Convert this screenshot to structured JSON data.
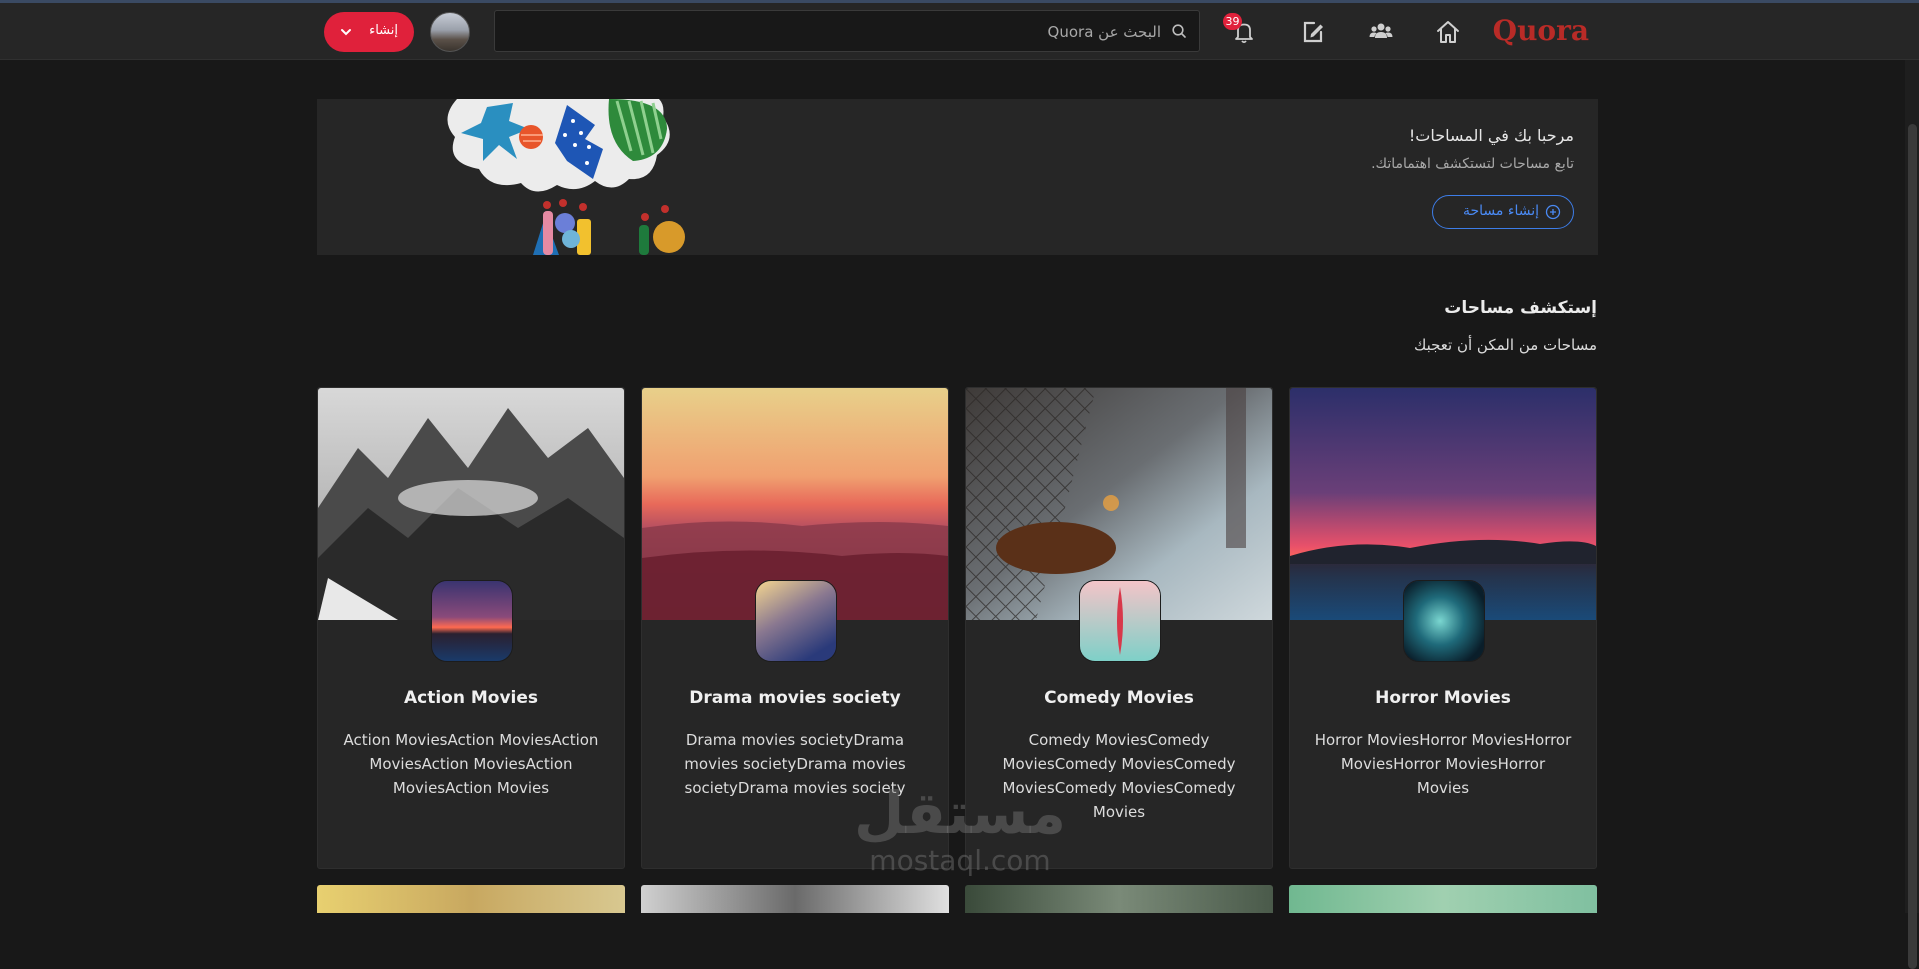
{
  "header": {
    "logo": "Quora",
    "search_placeholder": "البحث عن Quora",
    "notifications_count": "39",
    "create_label": "إنشاء"
  },
  "banner": {
    "title": "مرحبا بك في المساحات!",
    "subtitle": "تابع مساحات لتستكشف اهتماماتك.",
    "button_label": "إنشاء مساحة"
  },
  "discover": {
    "title": "إستكشف مساحات",
    "subtitle": "مساحات من المكن أن تعجبك"
  },
  "cards": [
    {
      "name": "Horror Movies",
      "description": "Horror MoviesHorror MoviesHorror MoviesHorror MoviesHorror Movies"
    },
    {
      "name": "Comedy Movies",
      "description": "Comedy MoviesComedy MoviesComedy MoviesComedy MoviesComedy MoviesComedy Movies"
    },
    {
      "name": "Drama movies society",
      "description": "Drama movies societyDrama movies societyDrama movies societyDrama movies society"
    },
    {
      "name": "Action Movies",
      "description": "Action MoviesAction MoviesAction MoviesAction MoviesAction MoviesAction Movies"
    }
  ],
  "watermark": {
    "arabic": "مستقل",
    "latin": "mostaql.com"
  },
  "colors": {
    "brand": "#b92b27",
    "accent_red": "#e0213b",
    "link_blue": "#4a8af4"
  }
}
